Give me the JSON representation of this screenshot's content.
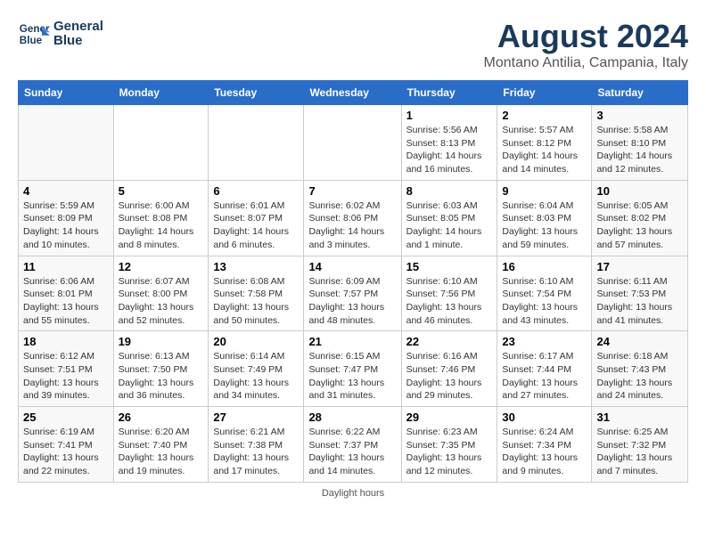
{
  "header": {
    "logo_line1": "General",
    "logo_line2": "Blue",
    "main_title": "August 2024",
    "sub_title": "Montano Antilia, Campania, Italy"
  },
  "days_of_week": [
    "Sunday",
    "Monday",
    "Tuesday",
    "Wednesday",
    "Thursday",
    "Friday",
    "Saturday"
  ],
  "weeks": [
    [
      {
        "num": "",
        "info": ""
      },
      {
        "num": "",
        "info": ""
      },
      {
        "num": "",
        "info": ""
      },
      {
        "num": "",
        "info": ""
      },
      {
        "num": "1",
        "info": "Sunrise: 5:56 AM\nSunset: 8:13 PM\nDaylight: 14 hours\nand 16 minutes."
      },
      {
        "num": "2",
        "info": "Sunrise: 5:57 AM\nSunset: 8:12 PM\nDaylight: 14 hours\nand 14 minutes."
      },
      {
        "num": "3",
        "info": "Sunrise: 5:58 AM\nSunset: 8:10 PM\nDaylight: 14 hours\nand 12 minutes."
      }
    ],
    [
      {
        "num": "4",
        "info": "Sunrise: 5:59 AM\nSunset: 8:09 PM\nDaylight: 14 hours\nand 10 minutes."
      },
      {
        "num": "5",
        "info": "Sunrise: 6:00 AM\nSunset: 8:08 PM\nDaylight: 14 hours\nand 8 minutes."
      },
      {
        "num": "6",
        "info": "Sunrise: 6:01 AM\nSunset: 8:07 PM\nDaylight: 14 hours\nand 6 minutes."
      },
      {
        "num": "7",
        "info": "Sunrise: 6:02 AM\nSunset: 8:06 PM\nDaylight: 14 hours\nand 3 minutes."
      },
      {
        "num": "8",
        "info": "Sunrise: 6:03 AM\nSunset: 8:05 PM\nDaylight: 14 hours\nand 1 minute."
      },
      {
        "num": "9",
        "info": "Sunrise: 6:04 AM\nSunset: 8:03 PM\nDaylight: 13 hours\nand 59 minutes."
      },
      {
        "num": "10",
        "info": "Sunrise: 6:05 AM\nSunset: 8:02 PM\nDaylight: 13 hours\nand 57 minutes."
      }
    ],
    [
      {
        "num": "11",
        "info": "Sunrise: 6:06 AM\nSunset: 8:01 PM\nDaylight: 13 hours\nand 55 minutes."
      },
      {
        "num": "12",
        "info": "Sunrise: 6:07 AM\nSunset: 8:00 PM\nDaylight: 13 hours\nand 52 minutes."
      },
      {
        "num": "13",
        "info": "Sunrise: 6:08 AM\nSunset: 7:58 PM\nDaylight: 13 hours\nand 50 minutes."
      },
      {
        "num": "14",
        "info": "Sunrise: 6:09 AM\nSunset: 7:57 PM\nDaylight: 13 hours\nand 48 minutes."
      },
      {
        "num": "15",
        "info": "Sunrise: 6:10 AM\nSunset: 7:56 PM\nDaylight: 13 hours\nand 46 minutes."
      },
      {
        "num": "16",
        "info": "Sunrise: 6:10 AM\nSunset: 7:54 PM\nDaylight: 13 hours\nand 43 minutes."
      },
      {
        "num": "17",
        "info": "Sunrise: 6:11 AM\nSunset: 7:53 PM\nDaylight: 13 hours\nand 41 minutes."
      }
    ],
    [
      {
        "num": "18",
        "info": "Sunrise: 6:12 AM\nSunset: 7:51 PM\nDaylight: 13 hours\nand 39 minutes."
      },
      {
        "num": "19",
        "info": "Sunrise: 6:13 AM\nSunset: 7:50 PM\nDaylight: 13 hours\nand 36 minutes."
      },
      {
        "num": "20",
        "info": "Sunrise: 6:14 AM\nSunset: 7:49 PM\nDaylight: 13 hours\nand 34 minutes."
      },
      {
        "num": "21",
        "info": "Sunrise: 6:15 AM\nSunset: 7:47 PM\nDaylight: 13 hours\nand 31 minutes."
      },
      {
        "num": "22",
        "info": "Sunrise: 6:16 AM\nSunset: 7:46 PM\nDaylight: 13 hours\nand 29 minutes."
      },
      {
        "num": "23",
        "info": "Sunrise: 6:17 AM\nSunset: 7:44 PM\nDaylight: 13 hours\nand 27 minutes."
      },
      {
        "num": "24",
        "info": "Sunrise: 6:18 AM\nSunset: 7:43 PM\nDaylight: 13 hours\nand 24 minutes."
      }
    ],
    [
      {
        "num": "25",
        "info": "Sunrise: 6:19 AM\nSunset: 7:41 PM\nDaylight: 13 hours\nand 22 minutes."
      },
      {
        "num": "26",
        "info": "Sunrise: 6:20 AM\nSunset: 7:40 PM\nDaylight: 13 hours\nand 19 minutes."
      },
      {
        "num": "27",
        "info": "Sunrise: 6:21 AM\nSunset: 7:38 PM\nDaylight: 13 hours\nand 17 minutes."
      },
      {
        "num": "28",
        "info": "Sunrise: 6:22 AM\nSunset: 7:37 PM\nDaylight: 13 hours\nand 14 minutes."
      },
      {
        "num": "29",
        "info": "Sunrise: 6:23 AM\nSunset: 7:35 PM\nDaylight: 13 hours\nand 12 minutes."
      },
      {
        "num": "30",
        "info": "Sunrise: 6:24 AM\nSunset: 7:34 PM\nDaylight: 13 hours\nand 9 minutes."
      },
      {
        "num": "31",
        "info": "Sunrise: 6:25 AM\nSunset: 7:32 PM\nDaylight: 13 hours\nand 7 minutes."
      }
    ]
  ],
  "footer": {
    "note": "Daylight hours"
  }
}
